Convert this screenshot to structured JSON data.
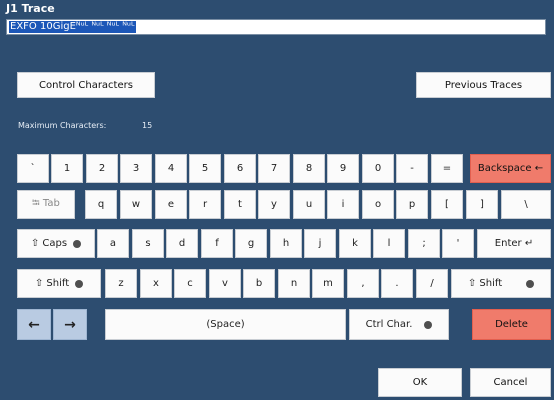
{
  "window": {
    "title": "J1 Trace"
  },
  "input": {
    "value": "EXFO 10GigEᴺᵘᴸ ᴺᵘᴸ ᴺᵘᴸ ᴺᵘᴸ"
  },
  "buttons": {
    "control_characters": "Control Characters",
    "previous_traces": "Previous Traces",
    "ok": "OK",
    "cancel": "Cancel"
  },
  "max": {
    "label": "Maximum Characters:",
    "value": "15"
  },
  "keys": {
    "row1": [
      "`",
      "1",
      "2",
      "3",
      "4",
      "5",
      "6",
      "7",
      "8",
      "9",
      "0",
      "-",
      "="
    ],
    "backspace": "Backspace ←",
    "tab": "⭾ Tab",
    "row2": [
      "q",
      "w",
      "e",
      "r",
      "t",
      "y",
      "u",
      "i",
      "o",
      "p",
      "[",
      "]",
      "\\"
    ],
    "caps": "⇧ Caps",
    "row3": [
      "a",
      "s",
      "d",
      "f",
      "g",
      "h",
      "j",
      "k",
      "l",
      ";",
      "'"
    ],
    "enter": "Enter ↵",
    "shift_left": "⇧ Shift",
    "row4": [
      "z",
      "x",
      "c",
      "v",
      "b",
      "n",
      "m",
      ",",
      ".",
      "/"
    ],
    "shift_right": "⇧ Shift",
    "left_arrow": "←",
    "right_arrow": "→",
    "space": "(Space)",
    "ctrl_char": "Ctrl Char.",
    "delete": "Delete"
  }
}
